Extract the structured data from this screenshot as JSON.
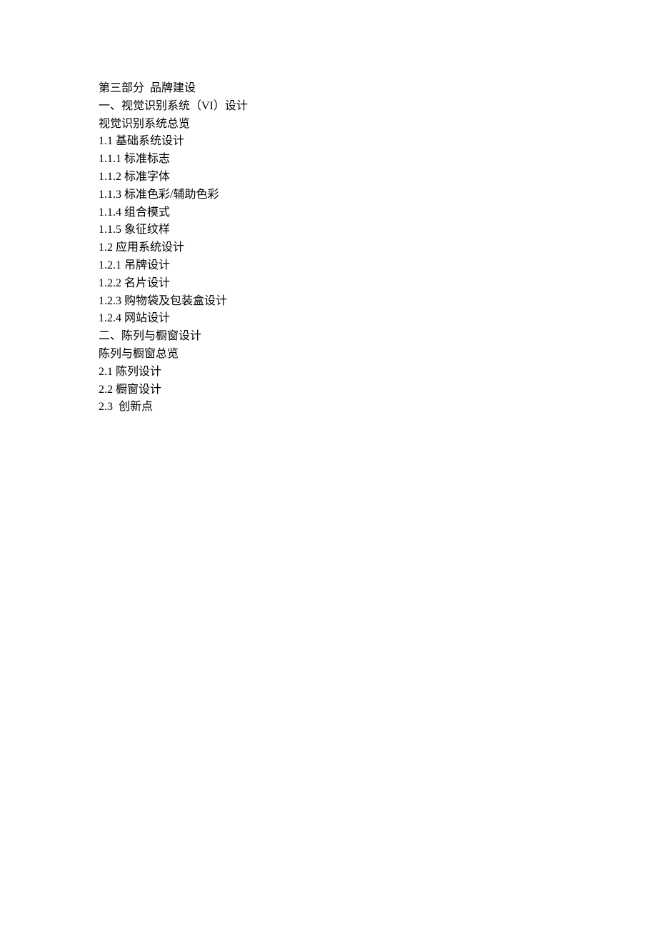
{
  "lines": [
    "第三部分  品牌建设",
    "一、视觉识别系统（VI）设计",
    "视觉识别系统总览",
    "1.1 基础系统设计",
    "1.1.1 标准标志",
    "1.1.2 标准字体",
    "1.1.3 标准色彩/辅助色彩",
    "1.1.4 组合模式",
    "1.1.5 象征纹样",
    "1.2 应用系统设计",
    "1.2.1 吊牌设计",
    "1.2.2 名片设计",
    "1.2.3 购物袋及包装盒设计",
    "1.2.4 网站设计",
    "二、陈列与橱窗设计",
    "陈列与橱窗总览",
    "2.1 陈列设计",
    "2.2 橱窗设计",
    "2.3  创新点"
  ]
}
